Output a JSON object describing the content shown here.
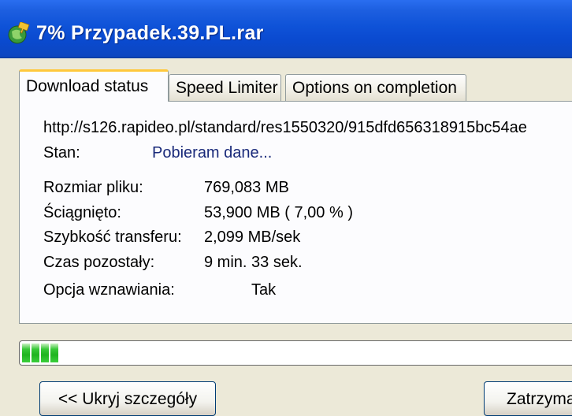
{
  "window": {
    "title": "7% Przypadek.39.PL.rar",
    "icon": "download-globe-icon",
    "title_bar_color": "#0a4ad0"
  },
  "tabs": [
    {
      "label": "Download status",
      "active": true
    },
    {
      "label": "Speed Limiter",
      "active": false
    },
    {
      "label": "Options on completion",
      "active": false
    }
  ],
  "status": {
    "url": "http://s126.rapideo.pl/standard/res1550320/915dfd656318915bc54ae",
    "state_label": "Stan:",
    "state_value": "Pobieram dane...",
    "details": [
      {
        "label": "Rozmiar pliku:",
        "value": "769,083  MB"
      },
      {
        "label": "Ściągnięto:",
        "value": "53,900  MB  ( 7,00 % )"
      },
      {
        "label": "Szybkość transferu:",
        "value": "2,099  MB/sek"
      },
      {
        "label": "Czas pozostały:",
        "value": "9 min. 33 sek."
      },
      {
        "label": "Opcja wznawiania:",
        "value": "Tak"
      }
    ]
  },
  "progress": {
    "percent": 7.0,
    "color": "#2fc22f"
  },
  "buttons": {
    "hide_details": "<< Ukryj szczegóły",
    "stop": "Zatrzymaj"
  }
}
